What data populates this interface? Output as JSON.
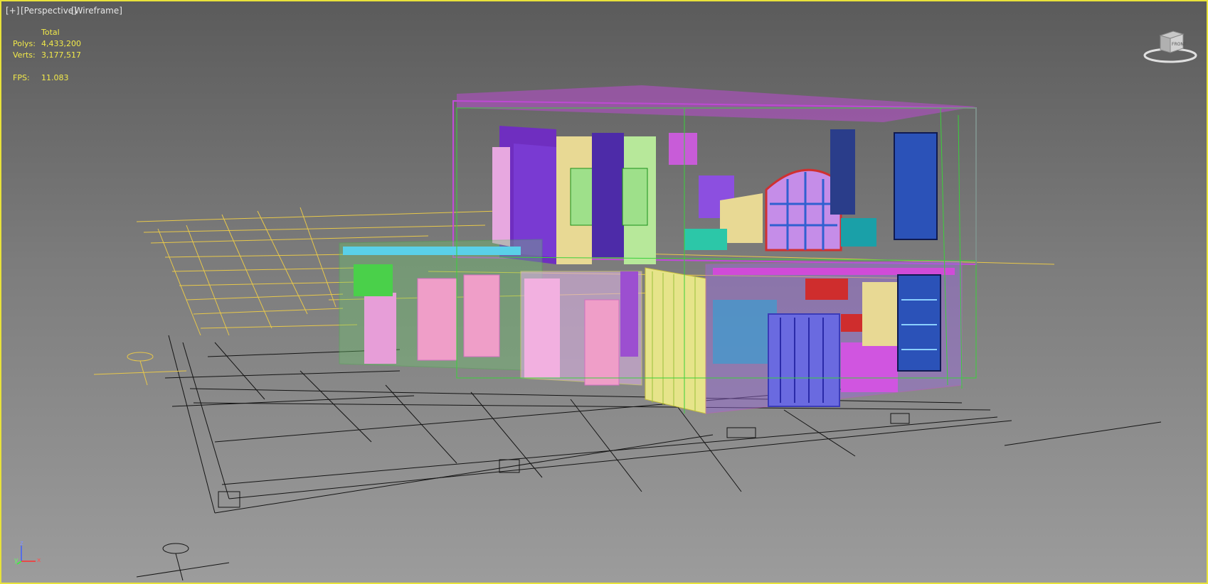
{
  "viewport": {
    "menu_label": "[+]",
    "view_label": "[Perspective]",
    "mode_label": "[Wireframe]"
  },
  "stats": {
    "header": "Total",
    "polys_label": "Polys:",
    "polys_value": "4,433,200",
    "verts_label": "Verts:",
    "verts_value": "3,177,517",
    "fps_label": "FPS:",
    "fps_value": "11.083"
  },
  "viewcube": {
    "face_label": "FRONT"
  },
  "axis": {
    "z": "z",
    "y": "y",
    "x": "x"
  },
  "colors": {
    "border": "#e8e23a",
    "stats_text": "#f2ea4a",
    "plan_lines": "#e8c84a",
    "ground_lines": "#111111"
  }
}
